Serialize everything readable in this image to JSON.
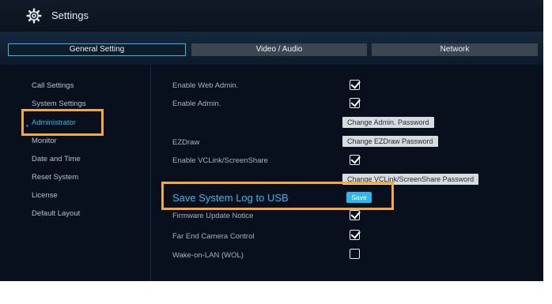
{
  "header": {
    "title": "Settings",
    "icon": "gear-icon"
  },
  "tabs": [
    {
      "label": "General Setting",
      "active": true
    },
    {
      "label": "Video / Audio",
      "active": false
    },
    {
      "label": "Network",
      "active": false
    }
  ],
  "sidebar": {
    "items": [
      {
        "label": "Call Settings"
      },
      {
        "label": "System Settings"
      },
      {
        "label": "Administrator",
        "active": true
      },
      {
        "label": "Monitor"
      },
      {
        "label": "Date and Time"
      },
      {
        "label": "Reset System"
      },
      {
        "label": "License"
      },
      {
        "label": "Default Layout"
      }
    ]
  },
  "settings": {
    "enable_web_admin": {
      "label": "Enable Web Admin.",
      "checked": true
    },
    "enable_admin": {
      "label": "Enable Admin.",
      "checked": true
    },
    "change_admin_password": "Change Admin. Password",
    "ezdraw": {
      "label": "EZDraw",
      "button": "Change EZDraw Password"
    },
    "enable_vclink": {
      "label": "Enable VCLink/ScreenShare",
      "checked": true
    },
    "change_vclink_password": "Change VCLink/ScreenShare Password",
    "save_log": {
      "label": "Save System Log to USB",
      "button": "Save"
    },
    "firmware_notice": {
      "label": "Firmware Update Notice",
      "checked": true
    },
    "far_end_camera": {
      "label": "Far End Camera Control",
      "checked": true
    },
    "wake_on_lan": {
      "label": "Wake-on-LAN (WOL)",
      "checked": false
    }
  },
  "colors": {
    "accent": "#2fb8ec",
    "highlight": "#f6a93b",
    "background": "#07101c"
  }
}
